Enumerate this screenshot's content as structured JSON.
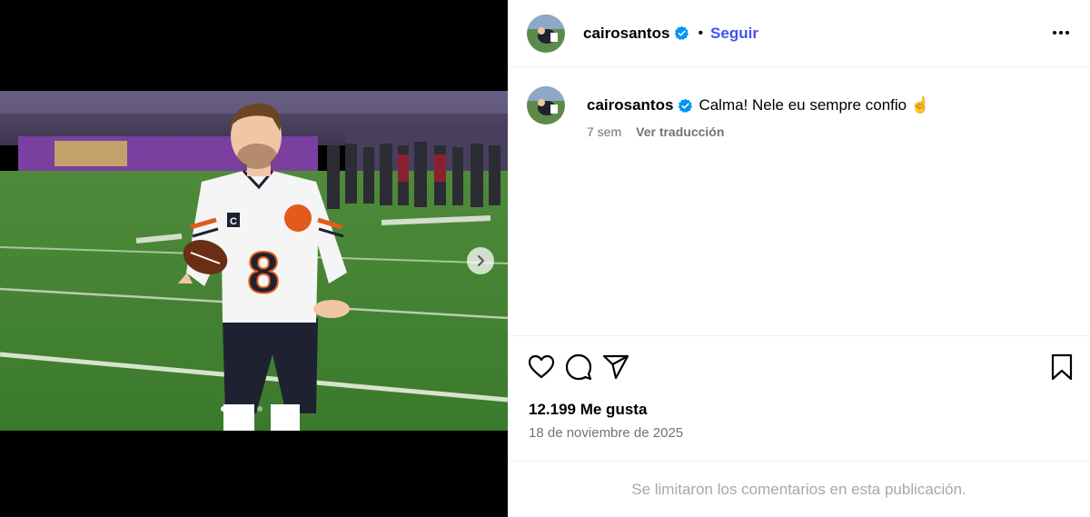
{
  "post": {
    "media": {
      "image_alt": "Football player in white number 8 jersey holding a ball on the field",
      "jersey_number": "8",
      "carousel_total": 5,
      "carousel_active": 1,
      "next_icon": "chevron-right-icon"
    },
    "header": {
      "username": "cairosantos",
      "verified": true,
      "separator": "•",
      "follow_label": "Seguir",
      "more_icon": "more-horizontal-icon"
    },
    "caption": {
      "username": "cairosantos",
      "text": "Calma! Nele eu sempre confio ☝️",
      "age": "7 sem",
      "translate_label": "Ver traducción"
    },
    "actions": {
      "like_icon": "heart-icon",
      "comment_icon": "comment-icon",
      "share_icon": "send-icon",
      "save_icon": "bookmark-icon"
    },
    "likes": "12.199 Me gusta",
    "date": "18 de noviembre de 2025",
    "comments_notice": "Se limitaron los comentarios en esta publicación."
  },
  "colors": {
    "accent": "#4150f7",
    "verified_blue": "#0095f6",
    "muted_text": "#737373",
    "disabled_text": "#a8a8a8"
  }
}
